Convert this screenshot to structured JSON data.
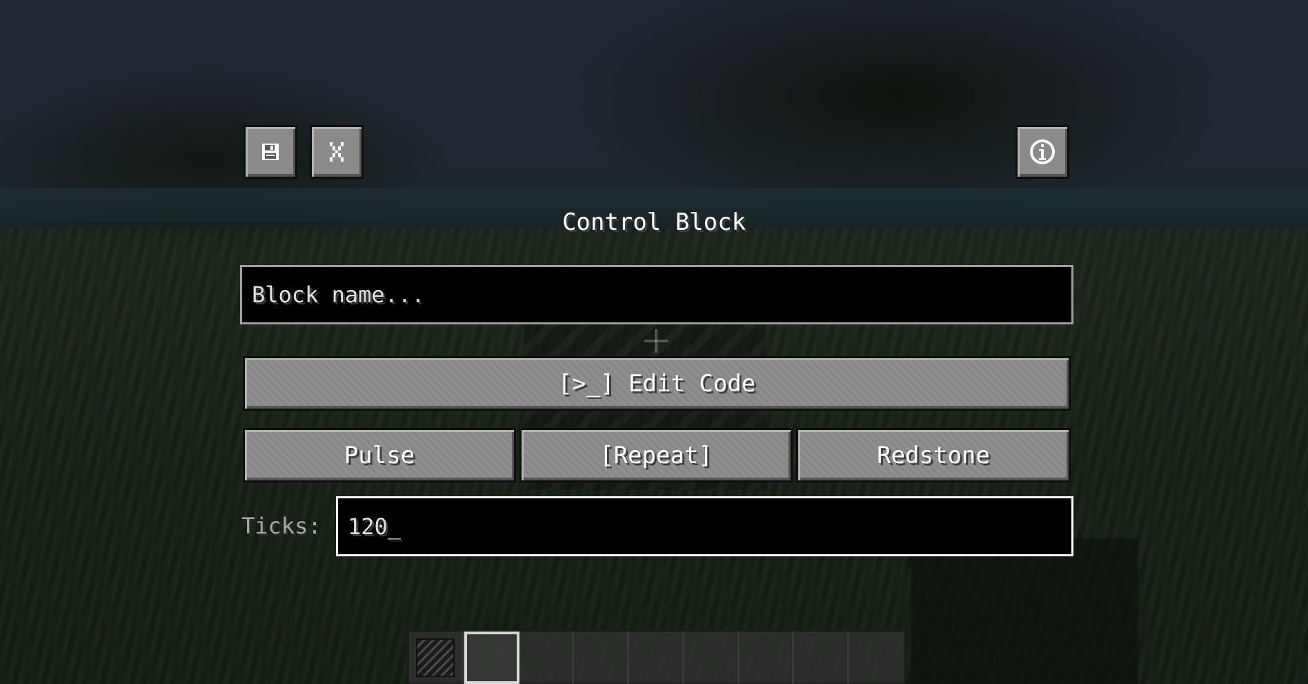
{
  "screen": {
    "title": "Control Block"
  },
  "toolbar": {
    "save_icon": "floppy-disk-icon",
    "close_icon": "x-close-icon",
    "info_icon": "info-icon"
  },
  "name_field": {
    "placeholder": "Block name..."
  },
  "buttons": {
    "edit_code": "[>_] Edit Code",
    "pulse": "Pulse",
    "repeat": "[Repeat]",
    "redstone": "Redstone"
  },
  "ticks": {
    "label": "Ticks:",
    "value": "120_"
  },
  "hotbar": {
    "slot_count": 9,
    "selected_slot": 2
  },
  "colors": {
    "button_face": "#8b8b8b",
    "field_bg": "#000000",
    "focused_border": "#ffffff"
  }
}
